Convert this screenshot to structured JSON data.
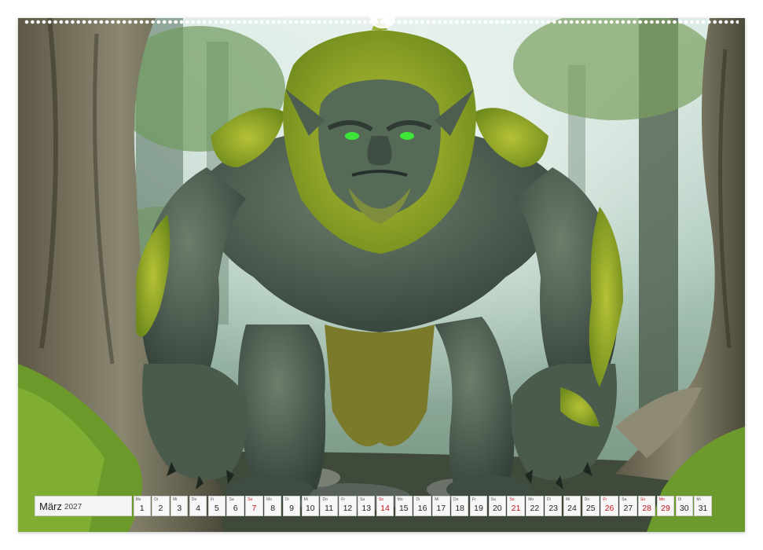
{
  "calendar": {
    "month": "März",
    "year": "2027",
    "days": [
      {
        "dow": "Mo",
        "num": "1",
        "red": false
      },
      {
        "dow": "Di",
        "num": "2",
        "red": false
      },
      {
        "dow": "Mi",
        "num": "3",
        "red": false
      },
      {
        "dow": "Do",
        "num": "4",
        "red": false
      },
      {
        "dow": "Fr",
        "num": "5",
        "red": false
      },
      {
        "dow": "Sa",
        "num": "6",
        "red": false
      },
      {
        "dow": "So",
        "num": "7",
        "red": true
      },
      {
        "dow": "Mo",
        "num": "8",
        "red": false
      },
      {
        "dow": "Di",
        "num": "9",
        "red": false
      },
      {
        "dow": "Mi",
        "num": "10",
        "red": false
      },
      {
        "dow": "Do",
        "num": "11",
        "red": false
      },
      {
        "dow": "Fr",
        "num": "12",
        "red": false
      },
      {
        "dow": "Sa",
        "num": "13",
        "red": false
      },
      {
        "dow": "So",
        "num": "14",
        "red": true
      },
      {
        "dow": "Mo",
        "num": "15",
        "red": false
      },
      {
        "dow": "Di",
        "num": "16",
        "red": false
      },
      {
        "dow": "Mi",
        "num": "17",
        "red": false
      },
      {
        "dow": "Do",
        "num": "18",
        "red": false
      },
      {
        "dow": "Fr",
        "num": "19",
        "red": false
      },
      {
        "dow": "Sa",
        "num": "20",
        "red": false
      },
      {
        "dow": "So",
        "num": "21",
        "red": true
      },
      {
        "dow": "Mo",
        "num": "22",
        "red": false
      },
      {
        "dow": "Di",
        "num": "23",
        "red": false
      },
      {
        "dow": "Mi",
        "num": "24",
        "red": false
      },
      {
        "dow": "Do",
        "num": "25",
        "red": false
      },
      {
        "dow": "Fr",
        "num": "26",
        "red": true
      },
      {
        "dow": "Sa",
        "num": "27",
        "red": false
      },
      {
        "dow": "So",
        "num": "28",
        "red": true
      },
      {
        "dow": "Mo",
        "num": "29",
        "red": true
      },
      {
        "dow": "Di",
        "num": "30",
        "red": false
      },
      {
        "dow": "Mi",
        "num": "31",
        "red": false
      }
    ]
  },
  "colors": {
    "holiday": "#c4121b",
    "moss": "#8fa82a",
    "skin": "#4a5a4c",
    "eyes": "#3ee63a",
    "forest_mist": "#bcd3c9"
  }
}
